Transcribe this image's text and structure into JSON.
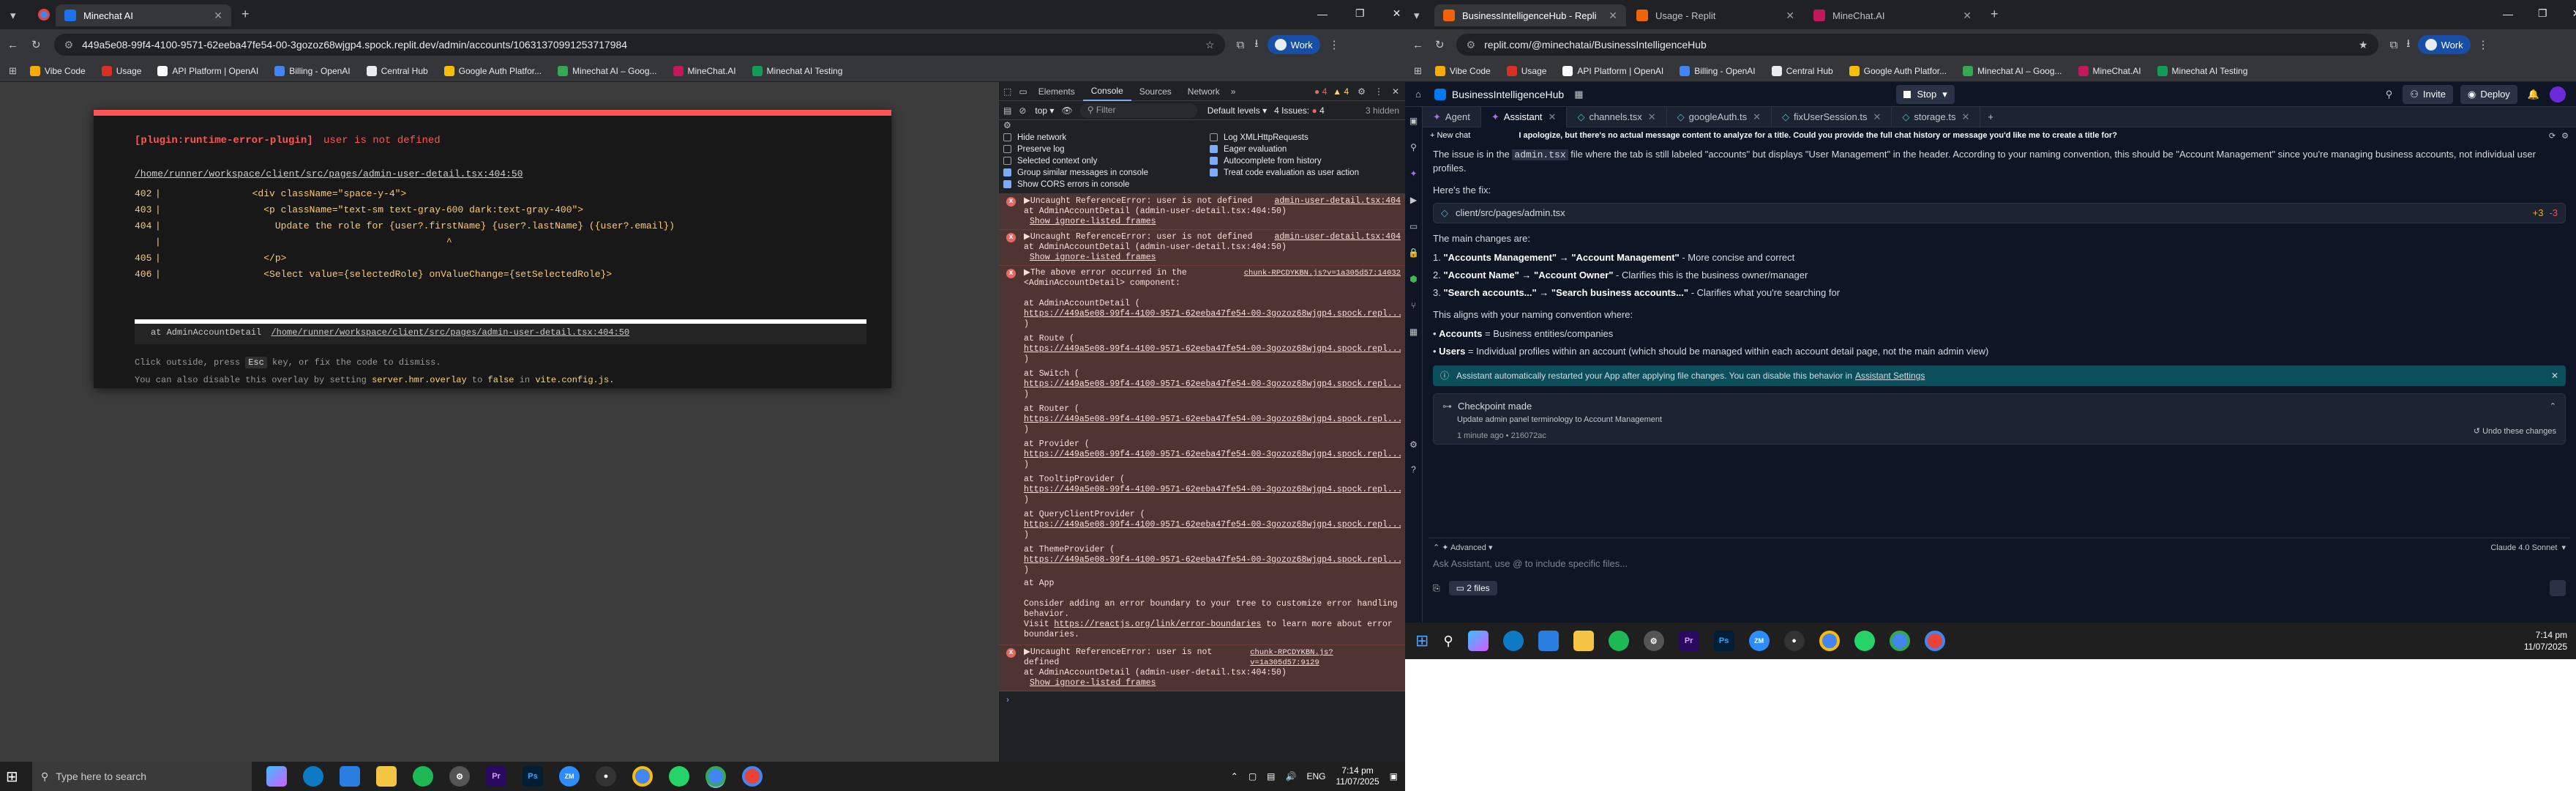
{
  "left": {
    "tab_title": "Minechat AI",
    "url": "449a5e08-99f4-4100-9571-62eeba47fe54-00-3gozoz68wjgp4.spock.replit.dev/admin/accounts/10631370991253717984",
    "profile": "Work",
    "bookmarks": [
      "Vibe Code",
      "Usage",
      "API Platform | OpenAI",
      "Billing - OpenAI",
      "Central Hub",
      "Google Auth Platfor...",
      "Minechat AI – Goog...",
      "MineChat.AI",
      "Minechat AI Testing"
    ],
    "overlay": {
      "title_plugin": "[plugin:runtime-error-plugin]",
      "title_msg": "user is not defined",
      "file": "/home/runner/workspace/client/src/pages/admin-user-detail.tsx:404:50",
      "code": [
        {
          "n": "402",
          "t": "                <div className=\"space-y-4\">"
        },
        {
          "n": "403",
          "t": "                  <p className=\"text-sm text-gray-600 dark:text-gray-400\">"
        },
        {
          "n": "404",
          "t": "                    Update the role for {user?.firstName} {user?.lastName} ({user?.email})"
        },
        {
          "n": "",
          "t": "                                                  ^"
        },
        {
          "n": "405",
          "t": "                  </p>"
        },
        {
          "n": "406",
          "t": "                  <Select value={selectedRole} onValueChange={setSelectedRole}>"
        }
      ],
      "stack_prefix": "at AdminAccountDetail",
      "stack_file": "/home/runner/workspace/client/src/pages/admin-user-detail.tsx:404:50",
      "hint1": "Click outside, press",
      "hint1_key": "Esc",
      "hint1_rest": "key, or fix the code to dismiss.",
      "hint2_a": "You can also disable this overlay by setting",
      "hint2_b": "server.hmr.overlay",
      "hint2_c": "to",
      "hint2_d": "false",
      "hint2_e": "in",
      "hint2_f": "vite.config.js."
    },
    "devtools": {
      "tabs": [
        "Elements",
        "Console",
        "Sources",
        "Network"
      ],
      "active_tab": "Console",
      "error_count": "4",
      "warn_count": "4",
      "context": "top",
      "filter_placeholder": "Filter",
      "levels": "Default levels",
      "issues": "4 Issues:",
      "issues_count": "4",
      "hidden": "3 hidden",
      "options_left": [
        {
          "label": "Hide network",
          "on": false
        },
        {
          "label": "Preserve log",
          "on": false
        },
        {
          "label": "Selected context only",
          "on": false
        },
        {
          "label": "Group similar messages in console",
          "on": true
        },
        {
          "label": "Show CORS errors in console",
          "on": true
        }
      ],
      "options_right": [
        {
          "label": "Log XMLHttpRequests",
          "on": false
        },
        {
          "label": "Eager evaluation",
          "on": true
        },
        {
          "label": "Autocomplete from history",
          "on": true
        },
        {
          "label": "Treat code evaluation as user action",
          "on": true
        }
      ],
      "errors": [
        {
          "msg": "▶Uncaught ReferenceError: user is not defined",
          "src": "admin-user-detail.tsx:404",
          "at": "    at AdminAccountDetail (admin-user-detail.tsx:404:50)",
          "show": "Show ignore-listed frames"
        },
        {
          "msg": "▶Uncaught ReferenceError: user is not defined",
          "src": "admin-user-detail.tsx:404",
          "at": "    at AdminAccountDetail (admin-user-detail.tsx:404:50)",
          "show": "Show ignore-listed frames"
        }
      ],
      "component_error": {
        "msg": "▶The above error occurred in the",
        "msg2": "<AdminAccountDetail> component:",
        "src": "chunk-RPCDYKBN.js?v=1a305d57:14032",
        "frames": [
          "    at AdminAccountDetail (",
          "    at Route (",
          "    at Switch (",
          "    at Router (",
          "    at Provider (",
          "    at TooltipProvider (",
          "    at QueryClientProvider (",
          "    at ThemeProvider ("
        ],
        "frame_url": "https://449a5e08-99f4-4100-9571-62eeba47fe54-00-3gozoz68wjgp4.spock.repl...",
        "last": "    at App",
        "consider": "Consider adding an error boundary to your tree to customize error handling behavior.",
        "visit_a": "Visit",
        "visit_link": "https://reactjs.org/link/error-boundaries",
        "visit_b": "to learn more about error boundaries."
      },
      "last_error": {
        "msg": "▶Uncaught ReferenceError: user is not defined",
        "src": "chunk-RPCDYKBN.js?v=1a305d57:9129",
        "at": "    at AdminAccountDetail (admin-user-detail.tsx:404:50)",
        "show": "Show ignore-listed frames"
      }
    }
  },
  "right": {
    "tabs": [
      "BusinessIntelligenceHub - Repli",
      "Usage - Replit",
      "MineChat.AI"
    ],
    "url": "replit.com/@minechatai/BusinessIntelligenceHub",
    "profile": "Work",
    "bookmarks": [
      "Vibe Code",
      "Usage",
      "API Platform | OpenAI",
      "Billing - OpenAI",
      "Central Hub",
      "Google Auth Platfor...",
      "Minechat AI – Goog...",
      "MineChat.AI",
      "Minechat AI Testing"
    ],
    "repl_name": "BusinessIntelligenceHub",
    "stop": "Stop",
    "invite": "Invite",
    "deploy": "Deploy",
    "tabs2": [
      "Agent",
      "Assistant",
      "channels.tsx",
      "googleAuth.ts",
      "fixUserSession.ts",
      "storage.ts"
    ],
    "new_chat": "New chat",
    "chat_title": "I apologize, but there's no actual message content to analyze for a title. Could you provide the full chat history or message you'd like me to create a title for?",
    "p1_a": "The issue is in the",
    "p1_code": "admin.tsx",
    "p1_b": "file where the tab is still labeled \"accounts\" but displays \"User Management\" in the header. According to your naming convention, this should be \"Account Management\" since you're managing business accounts, not individual user profiles.",
    "fix_label": "Here's the fix:",
    "file_path": "client/src/pages/admin.tsx",
    "diff_add": "+3",
    "diff_del": "-3",
    "changes_label": "The main changes are:",
    "changes": [
      {
        "b": "\"Accounts Management\" → \"Account Management\"",
        "r": " - More concise and correct"
      },
      {
        "b": "\"Account Name\" → \"Account Owner\"",
        "r": " - Clarifies this is the business owner/manager"
      },
      {
        "b": "\"Search accounts...\" → \"Search business accounts...\"",
        "r": " - Clarifies what you're searching for"
      }
    ],
    "align_label": "This aligns with your naming convention where:",
    "bullets": [
      {
        "b": "Accounts",
        "r": " = Business entities/companies"
      },
      {
        "b": "Users",
        "r": " = Individual profiles within an account (which should be managed within each account detail page, not the main admin view)"
      }
    ],
    "notice_a": "Assistant automatically restarted your App after applying file changes. You can disable this behavior in",
    "notice_link": "Assistant Settings",
    "checkpoint_title": "Checkpoint made",
    "checkpoint_desc": "Update admin panel terminology to Account Management",
    "checkpoint_time": "1 minute ago",
    "checkpoint_hash": "216072ac",
    "undo": "Undo these changes",
    "advanced": "Advanced",
    "model": "Claude 4.0 Sonnet",
    "input_placeholder": "Ask Assistant, use @ to include specific files...",
    "files_count": "2 files"
  },
  "taskbar_left": {
    "search_placeholder": "Type here to search",
    "apps": [
      "Pr",
      "Ps",
      "ZM"
    ],
    "tray_lang": "ENG",
    "time": "7:14 pm",
    "date": "11/07/2025"
  },
  "taskbar_right": {
    "time": "7:14 pm",
    "date": "11/07/2025"
  }
}
